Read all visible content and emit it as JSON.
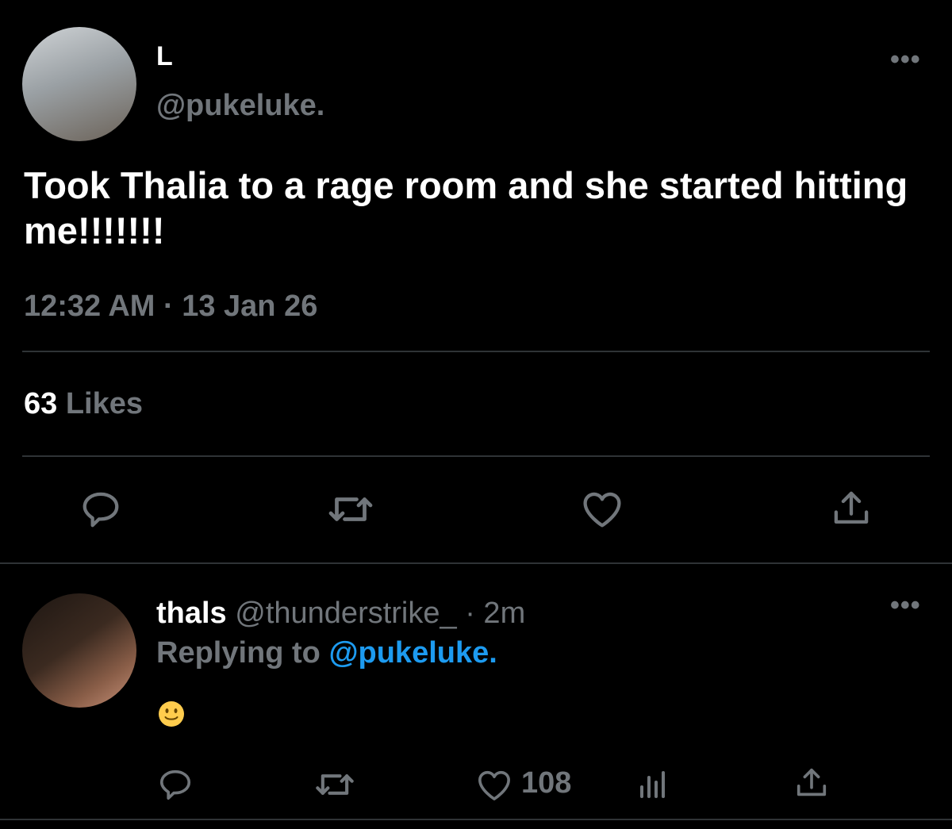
{
  "tweet": {
    "author_name": "L",
    "author_handle": "@pukeluke.",
    "text": "Took Thalia to a rage room and she started hitting me!!!!!!!",
    "timestamp": "12:32 AM · 13 Jan 26",
    "likes_count": "63",
    "likes_label": "Likes",
    "more_label": "•••"
  },
  "reply": {
    "author_name": "thals",
    "author_handle": "@thunderstrike_",
    "time": "· 2m",
    "replying_prefix": "Replying to",
    "replying_handle": "@pukeluke.",
    "content": "🙂",
    "like_count": "108",
    "more_label": "•••"
  },
  "icons": {
    "tweet_actions": [
      "reply-icon",
      "retweet-icon",
      "like-icon",
      "share-icon"
    ],
    "reply_actions": [
      "reply-icon",
      "retweet-icon",
      "like-icon",
      "analytics-icon",
      "share-icon"
    ]
  },
  "colors": {
    "background": "#000000",
    "primary_text": "#ffffff",
    "secondary_text": "#71767b",
    "accent": "#1d9bf0",
    "divider": "#2f3336"
  }
}
